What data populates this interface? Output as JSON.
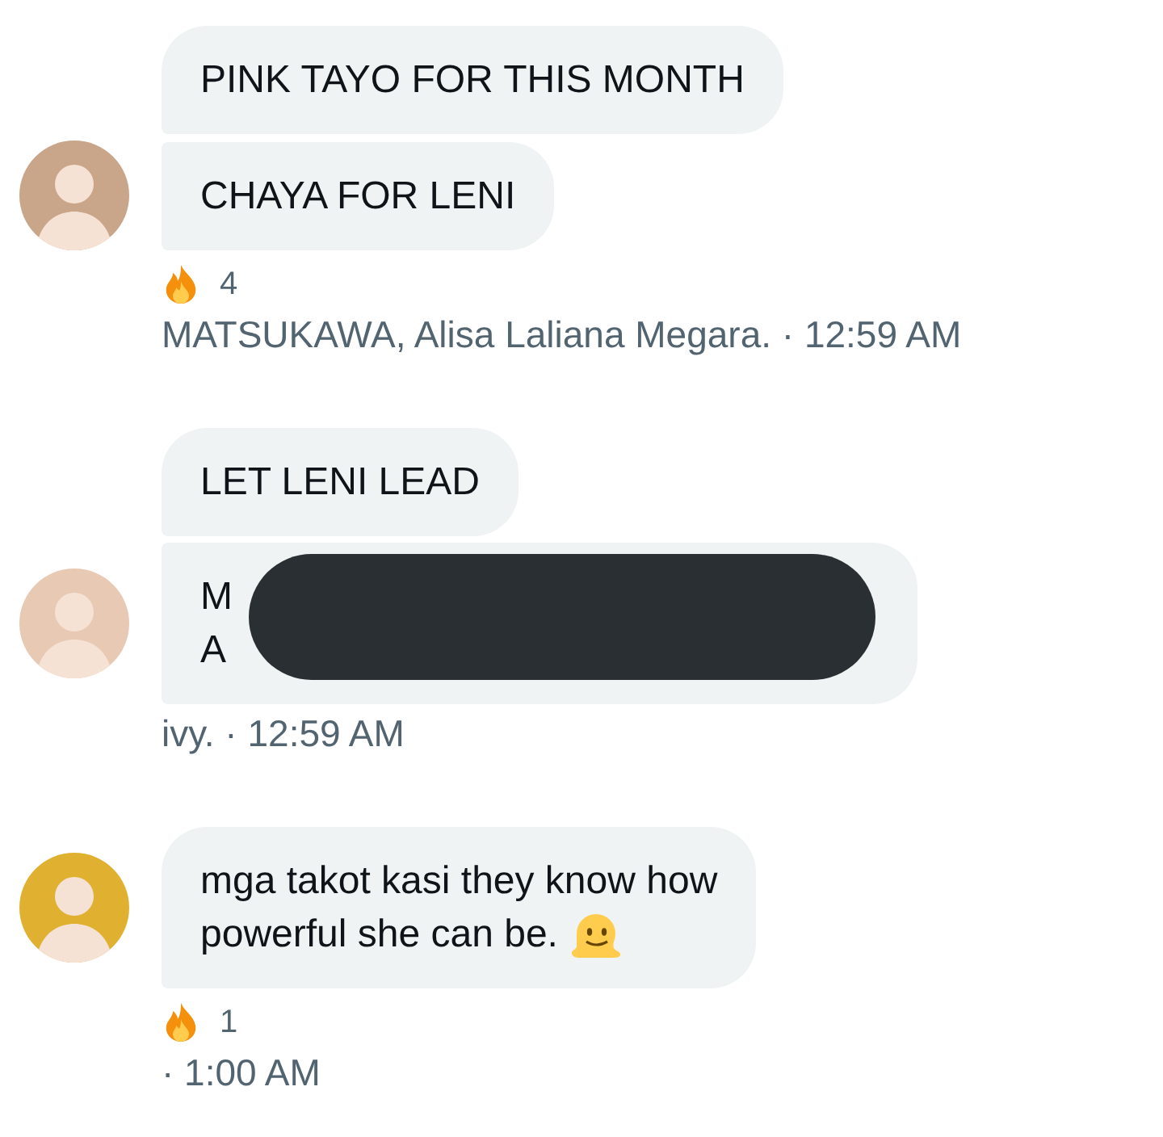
{
  "groups": [
    {
      "messages": [
        {
          "kind": "plain",
          "lines": [
            "PINK TAYO FOR THIS MONTH"
          ]
        },
        {
          "kind": "plain",
          "lines": [
            "CHAYA FOR LENI"
          ]
        }
      ],
      "reaction": {
        "count": "4"
      },
      "meta": "MATSUKAWA, Alisa Laliana Megara. · 12:59 AM"
    },
    {
      "messages": [
        {
          "kind": "plain",
          "lines": [
            "LET LENI LEAD"
          ]
        },
        {
          "kind": "redacted",
          "lines": [
            "M",
            "A"
          ]
        }
      ],
      "meta": "ivy. · 12:59 AM"
    },
    {
      "messages": [
        {
          "kind": "emoji",
          "lines": [
            "mga takot kasi they know how",
            "powerful she can be."
          ]
        }
      ],
      "reaction": {
        "count": "1"
      },
      "meta": "· 1:00 AM"
    }
  ]
}
